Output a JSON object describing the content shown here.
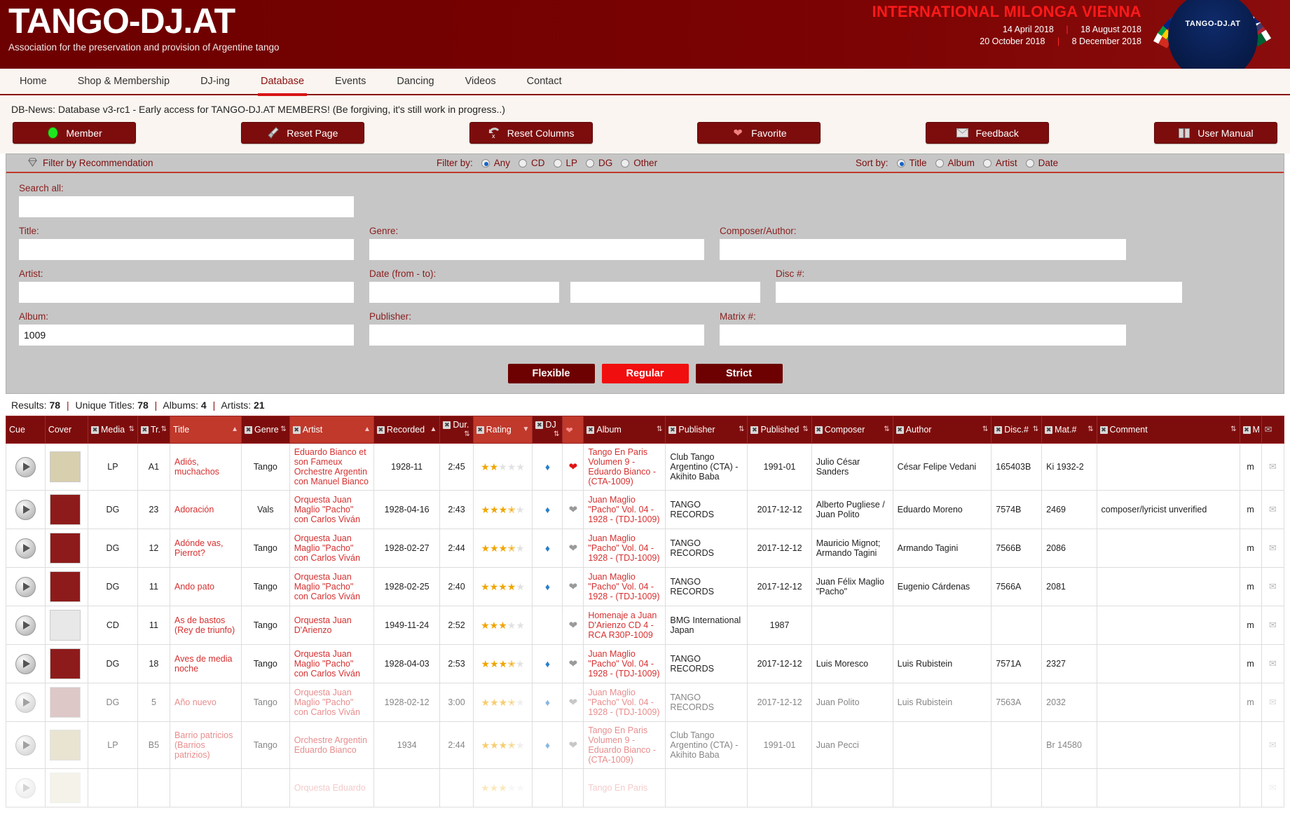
{
  "header": {
    "brand_title": "TANGO-DJ.AT",
    "brand_subtitle": "Association for the preservation and provision of Argentine tango",
    "milonga_title": "INTERNATIONAL MILONGA VIENNA",
    "milonga_dates": [
      {
        "left": "14 April 2018",
        "right": "18 August 2018"
      },
      {
        "left": "20 October 2018",
        "right": "8 December 2018"
      }
    ],
    "logo_label": "TANGO-DJ.AT"
  },
  "nav": {
    "items": [
      {
        "label": "Home",
        "active": false
      },
      {
        "label": "Shop & Membership",
        "active": false
      },
      {
        "label": "DJ-ing",
        "active": false
      },
      {
        "label": "Database",
        "active": true
      },
      {
        "label": "Events",
        "active": false
      },
      {
        "label": "Dancing",
        "active": false
      },
      {
        "label": "Videos",
        "active": false
      },
      {
        "label": "Contact",
        "active": false
      }
    ]
  },
  "news": "DB-News: Database v3-rc1 - Early access for TANGO-DJ.AT MEMBERS! (Be forgiving, it's still work in progress..)",
  "toolbar": {
    "member_label": "Member",
    "reset_page_label": "Reset Page",
    "reset_columns_label": "Reset Columns",
    "favorite_label": "Favorite",
    "feedback_label": "Feedback",
    "user_manual_label": "User Manual"
  },
  "filterbar": {
    "recommendation_label": "Filter by Recommendation",
    "filter_by_label": "Filter by:",
    "filter_options": [
      "Any",
      "CD",
      "LP",
      "DG",
      "Other"
    ],
    "filter_selected": "Any",
    "sort_by_label": "Sort by:",
    "sort_options": [
      "Title",
      "Album",
      "Artist",
      "Date"
    ],
    "sort_selected": "Title"
  },
  "search_form": {
    "search_all_label": "Search all:",
    "search_all_value": "",
    "title_label": "Title:",
    "title_value": "",
    "artist_label": "Artist:",
    "artist_value": "",
    "album_label": "Album:",
    "album_value": "1009",
    "genre_label": "Genre:",
    "genre_value": "",
    "date_label": "Date (from - to):",
    "date_from_value": "",
    "date_to_value": "",
    "publisher_label": "Publisher:",
    "publisher_value": "",
    "composer_label": "Composer/Author:",
    "composer_value": "",
    "disc_label": "Disc #:",
    "disc_value": "",
    "matrix_label": "Matrix #:",
    "matrix_value": "",
    "modes": [
      {
        "label": "Flexible",
        "selected": false
      },
      {
        "label": "Regular",
        "selected": true
      },
      {
        "label": "Strict",
        "selected": false
      }
    ]
  },
  "results": {
    "results_label": "Results:",
    "results_count": "78",
    "unique_titles_label": "Unique Titles:",
    "unique_titles_count": "78",
    "albums_label": "Albums:",
    "albums_count": "4",
    "artists_label": "Artists:",
    "artists_count": "21"
  },
  "table": {
    "columns": [
      {
        "key": "cue",
        "label": "Cue",
        "hide": false,
        "sort": "",
        "alt": false
      },
      {
        "key": "cover",
        "label": "Cover",
        "hide": false,
        "sort": "",
        "alt": false
      },
      {
        "key": "media",
        "label": "Media",
        "hide": true,
        "sort": "both",
        "alt": false
      },
      {
        "key": "tr",
        "label": "Tr.",
        "hide": true,
        "sort": "both",
        "alt": false
      },
      {
        "key": "title",
        "label": "Title",
        "hide": false,
        "sort": "asc",
        "alt": true
      },
      {
        "key": "genre",
        "label": "Genre",
        "hide": true,
        "sort": "both",
        "alt": false
      },
      {
        "key": "artist",
        "label": "Artist",
        "hide": true,
        "sort": "asc",
        "alt": true
      },
      {
        "key": "recorded",
        "label": "Recorded",
        "hide": true,
        "sort": "asc",
        "alt": false
      },
      {
        "key": "dur",
        "label": "Dur.",
        "hide": true,
        "sort": "both",
        "alt": false
      },
      {
        "key": "rating",
        "label": "Rating",
        "hide": true,
        "sort": "desc",
        "alt": true
      },
      {
        "key": "dj",
        "label": "DJ",
        "hide": true,
        "sort": "both",
        "alt": false
      },
      {
        "key": "fav",
        "label": "",
        "hide": false,
        "sort": "",
        "alt": true
      },
      {
        "key": "album",
        "label": "Album",
        "hide": true,
        "sort": "both",
        "alt": false
      },
      {
        "key": "publisher",
        "label": "Publisher",
        "hide": true,
        "sort": "both",
        "alt": false
      },
      {
        "key": "published",
        "label": "Published",
        "hide": true,
        "sort": "both",
        "alt": false
      },
      {
        "key": "composer",
        "label": "Composer",
        "hide": true,
        "sort": "both",
        "alt": false
      },
      {
        "key": "author",
        "label": "Author",
        "hide": true,
        "sort": "both",
        "alt": false
      },
      {
        "key": "disc",
        "label": "Disc.#",
        "hide": true,
        "sort": "both",
        "alt": false
      },
      {
        "key": "mat",
        "label": "Mat.#",
        "hide": true,
        "sort": "both",
        "alt": false
      },
      {
        "key": "comment",
        "label": "Comment",
        "hide": true,
        "sort": "both",
        "alt": false
      },
      {
        "key": "m",
        "label": "M",
        "hide": true,
        "sort": "",
        "alt": false
      },
      {
        "key": "mail",
        "label": "",
        "hide": false,
        "sort": "",
        "alt": false
      }
    ],
    "rows": [
      {
        "media": "LP",
        "tr": "A1",
        "title": "Adiós, muchachos",
        "genre": "Tango",
        "artist": "Eduardo Bianco et son Fameux Orchestre Argentin con Manuel Bianco",
        "recorded": "1928-11",
        "dur": "2:45",
        "rating": 2,
        "dj": true,
        "fav": "red",
        "album": "Tango En Paris Volumen 9 - Eduardo Bianco - (CTA-1009)",
        "publisher": "Club Tango Argentino (CTA) - Akihito Baba",
        "published": "1991-01",
        "composer": "Julio César Sanders",
        "author": "César Felipe Vedani",
        "disc": "165403B",
        "mat": "Ki 1932-2",
        "comment": "",
        "m": "m",
        "cover": "#d8cfae",
        "fade": 0
      },
      {
        "media": "DG",
        "tr": "23",
        "title": "Adoración",
        "genre": "Vals",
        "artist": "Orquesta Juan Maglio \"Pacho\" con Carlos Viván",
        "recorded": "1928-04-16",
        "dur": "2:43",
        "rating": 3.5,
        "dj": true,
        "fav": "gray",
        "album": "Juan Maglio \"Pacho\" Vol. 04 - 1928 - (TDJ-1009)",
        "publisher": "TANGO RECORDS",
        "published": "2017-12-12",
        "composer": "Alberto Pugliese / Juan Polito",
        "author": "Eduardo Moreno",
        "disc": "7574B",
        "mat": "2469",
        "comment": "composer/lyricist unverified",
        "m": "m",
        "cover": "#8e1b1b",
        "fade": 0
      },
      {
        "media": "DG",
        "tr": "12",
        "title": "Adónde vas, Pierrot?",
        "genre": "Tango",
        "artist": "Orquesta Juan Maglio \"Pacho\" con Carlos Viván",
        "recorded": "1928-02-27",
        "dur": "2:44",
        "rating": 3.5,
        "dj": true,
        "fav": "gray",
        "album": "Juan Maglio \"Pacho\" Vol. 04 - 1928 - (TDJ-1009)",
        "publisher": "TANGO RECORDS",
        "published": "2017-12-12",
        "composer": "Mauricio Mignot; Armando Tagini",
        "author": "Armando Tagini",
        "disc": "7566B",
        "mat": "2086",
        "comment": "",
        "m": "m",
        "cover": "#8e1b1b",
        "fade": 0
      },
      {
        "media": "DG",
        "tr": "11",
        "title": "Ando pato",
        "genre": "Tango",
        "artist": "Orquesta Juan Maglio \"Pacho\" con Carlos Viván",
        "recorded": "1928-02-25",
        "dur": "2:40",
        "rating": 4,
        "dj": true,
        "fav": "gray",
        "album": "Juan Maglio \"Pacho\" Vol. 04 - 1928 - (TDJ-1009)",
        "publisher": "TANGO RECORDS",
        "published": "2017-12-12",
        "composer": "Juan Félix Maglio \"Pacho\"",
        "author": "Eugenio Cárdenas",
        "disc": "7566A",
        "mat": "2081",
        "comment": "",
        "m": "m",
        "cover": "#8e1b1b",
        "fade": 0
      },
      {
        "media": "CD",
        "tr": "11",
        "title": "As de bastos (Rey de triunfo)",
        "genre": "Tango",
        "artist": "Orquesta Juan D'Arienzo",
        "recorded": "1949-11-24",
        "dur": "2:52",
        "rating": 3,
        "dj": false,
        "fav": "gray",
        "album": "Homenaje a Juan D'Arienzo CD 4 - RCA R30P-1009",
        "publisher": "BMG International Japan",
        "published": "1987",
        "composer": "",
        "author": "",
        "disc": "",
        "mat": "",
        "comment": "",
        "m": "m",
        "cover": "#e8e8e8",
        "fade": 0
      },
      {
        "media": "DG",
        "tr": "18",
        "title": "Aves de media noche",
        "genre": "Tango",
        "artist": "Orquesta Juan Maglio \"Pacho\" con Carlos Viván",
        "recorded": "1928-04-03",
        "dur": "2:53",
        "rating": 3.5,
        "dj": true,
        "fav": "gray",
        "album": "Juan Maglio \"Pacho\" Vol. 04 - 1928 - (TDJ-1009)",
        "publisher": "TANGO RECORDS",
        "published": "2017-12-12",
        "composer": "Luis Moresco",
        "author": "Luis Rubistein",
        "disc": "7571A",
        "mat": "2327",
        "comment": "",
        "m": "m",
        "cover": "#8e1b1b",
        "fade": 0
      },
      {
        "media": "DG",
        "tr": "5",
        "title": "Año nuevo",
        "genre": "Tango",
        "artist": "Orquesta Juan Maglio \"Pacho\" con Carlos Viván",
        "recorded": "1928-02-12",
        "dur": "3:00",
        "rating": 3.5,
        "dj": true,
        "fav": "gray",
        "album": "Juan Maglio \"Pacho\" Vol. 04 - 1928 - (TDJ-1009)",
        "publisher": "TANGO RECORDS",
        "published": "2017-12-12",
        "composer": "Juan Polito",
        "author": "Luis Rubistein",
        "disc": "7563A",
        "mat": "2032",
        "comment": "",
        "m": "m",
        "cover": "#c49a9a",
        "fade": 1
      },
      {
        "media": "LP",
        "tr": "B5",
        "title": "Barrio patricios (Barrios patrizios)",
        "genre": "Tango",
        "artist": "Orchestre Argentin Eduardo Bianco",
        "recorded": "1934",
        "dur": "2:44",
        "rating": 3.5,
        "dj": true,
        "fav": "gray",
        "album": "Tango En Paris Volumen 9 - Eduardo Bianco - (CTA-1009)",
        "publisher": "Club Tango Argentino (CTA) - Akihito Baba",
        "published": "1991-01",
        "composer": "Juan Pecci",
        "author": "",
        "disc": "",
        "mat": "Br 14580",
        "comment": "",
        "m": "",
        "cover": "#d8cfae",
        "fade": 1
      },
      {
        "media": "",
        "tr": "",
        "title": "",
        "genre": "",
        "artist": "Orquesta Eduardo",
        "recorded": "",
        "dur": "",
        "rating": 3,
        "dj": false,
        "fav": "",
        "album": "Tango En Paris",
        "publisher": "",
        "published": "",
        "composer": "",
        "author": "",
        "disc": "",
        "mat": "",
        "comment": "",
        "m": "",
        "cover": "#d8cfae",
        "fade": 2
      }
    ]
  }
}
